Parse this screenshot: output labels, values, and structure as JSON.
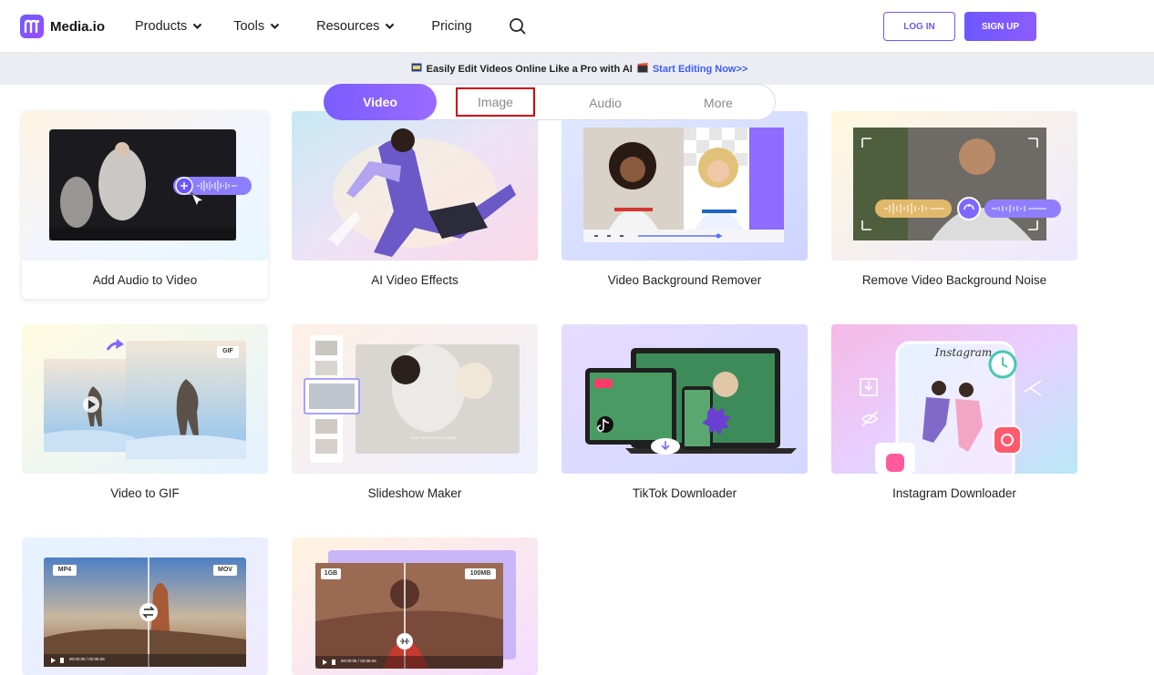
{
  "header": {
    "logo_text": "Media.io",
    "nav": [
      {
        "label": "Products"
      },
      {
        "label": "Tools"
      },
      {
        "label": "Resources"
      },
      {
        "label": "Pricing"
      }
    ],
    "login_label": "LOG IN",
    "signup_label": "SIGN UP"
  },
  "banner": {
    "text": "Easily Edit Videos Online Like a Pro with AI",
    "link": "Start Editing Now>>"
  },
  "tabs": [
    {
      "label": "Video",
      "active": true
    },
    {
      "label": "Image",
      "active": false
    },
    {
      "label": "Audio",
      "active": false
    },
    {
      "label": "More",
      "active": false
    }
  ],
  "cards": [
    {
      "title": "Add Audio to Video"
    },
    {
      "title": "AI Video Effects"
    },
    {
      "title": "Video Background Remover"
    },
    {
      "title": "Remove Video Background Noise"
    },
    {
      "title": "Video to GIF",
      "badges": [
        "GIF"
      ]
    },
    {
      "title": "Slideshow Maker",
      "caption": "OUR WEDDING VIDEO"
    },
    {
      "title": "TikTok Downloader"
    },
    {
      "title": "Instagram Downloader",
      "caption": "Instagram"
    },
    {
      "title": "",
      "badges": [
        "MP4",
        "MOV"
      ],
      "time": "00:00:05 / 02:05:06"
    },
    {
      "title": "",
      "badges": [
        "1GB",
        "100MB"
      ],
      "time": "00:00:05 / 02:05:06"
    }
  ],
  "colors": {
    "accent": "#6d57ff",
    "banner_link": "#3b5cff",
    "highlight_box": "#d10000"
  }
}
